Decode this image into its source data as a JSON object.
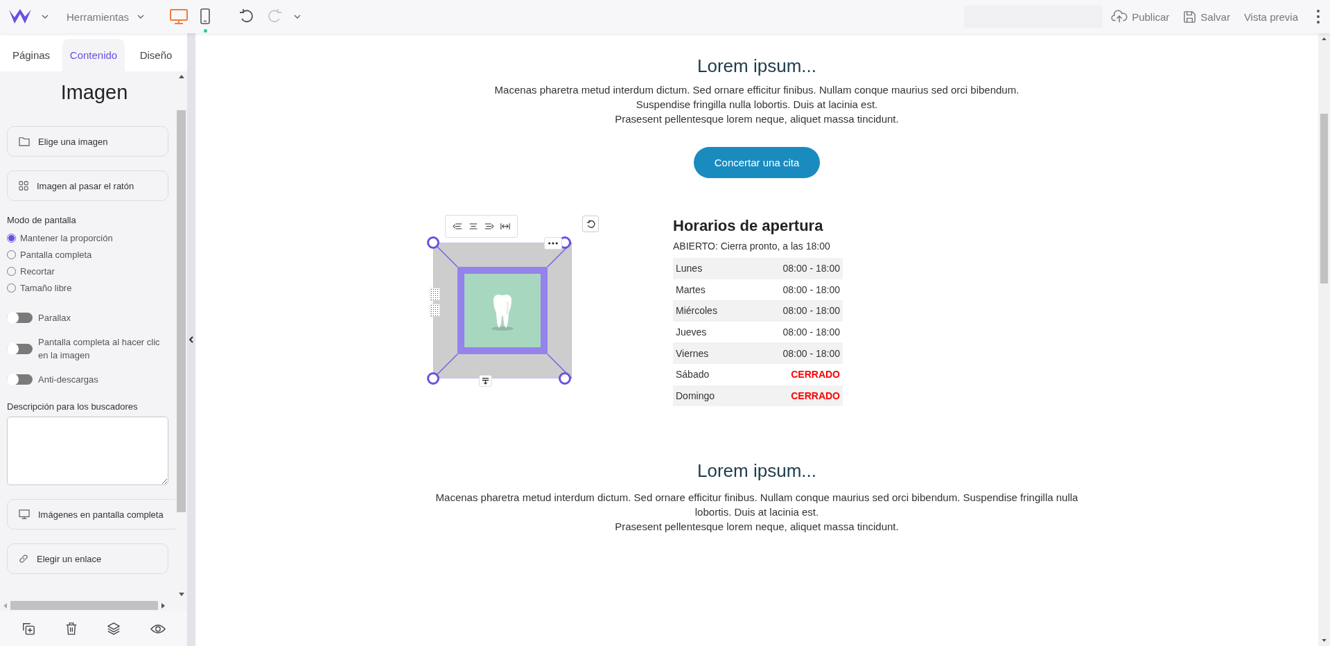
{
  "topbar": {
    "menu": "Herramientas",
    "devices": [
      {
        "kind": "desktop",
        "selected": true
      },
      {
        "kind": "mobile",
        "selected": false
      }
    ],
    "history": [
      {
        "kind": "undo",
        "disabled": false
      },
      {
        "kind": "redo",
        "disabled": true
      }
    ],
    "actions": [
      {
        "kind": "upload",
        "label": "Publicar"
      },
      {
        "kind": "save",
        "label": "Salvar"
      },
      {
        "kind": "none",
        "label": "Vista previa"
      }
    ]
  },
  "panel": {
    "tabs": [
      {
        "label": "Páginas",
        "selected": false
      },
      {
        "label": "Contenido",
        "selected": true
      },
      {
        "label": "Diseño",
        "selected": false
      }
    ],
    "title": "Imagen",
    "buttons": [
      {
        "kind": "folder",
        "label": "Elige una imagen"
      },
      {
        "kind": "grid",
        "label": "Imagen al pasar el ratón"
      }
    ],
    "mode_label": "Modo de pantalla",
    "modes": [
      {
        "label": "Mantener la proporción",
        "selected": true
      },
      {
        "label": "Pantalla completa",
        "selected": false
      },
      {
        "label": "Recortar",
        "selected": false
      },
      {
        "label": "Tamaño libre",
        "selected": false
      }
    ],
    "toggles": [
      {
        "label": "Parallax",
        "on": false
      },
      {
        "label": "Pantalla completa al hacer clic en la imagen",
        "on": false
      },
      {
        "label": "Anti-descargas",
        "on": false
      }
    ],
    "description_label": "Descripción para los buscadores",
    "more_buttons": [
      {
        "kind": "monitor",
        "label": "Imágenes en pantalla completa"
      },
      {
        "kind": "link",
        "label": "Elegir un enlace"
      }
    ]
  },
  "canvas": {
    "intro": {
      "heading": "Lorem ipsum...",
      "lines": [
        "Macenas pharetra metud interdum dictum. Sed ornare efficitur finibus. Nullam conque maurius sed orci bibendum.",
        "Suspendise fringilla nulla lobortis. Duis at lacinia est.",
        "Prasesent pellentesque lorem neque, aliquet massa tincidunt."
      ],
      "button": "Concertar una cita"
    },
    "hours": {
      "heading": "Horarios de apertura",
      "status": "ABIERTO: Cierra pronto, a las 18:00",
      "rows": [
        {
          "day": "Lunes",
          "hours": "08:00 - 18:00",
          "closed": false
        },
        {
          "day": "Martes",
          "hours": "08:00 - 18:00",
          "closed": false
        },
        {
          "day": "Miércoles",
          "hours": "08:00 - 18:00",
          "closed": false
        },
        {
          "day": "Jueves",
          "hours": "08:00 - 18:00",
          "closed": false
        },
        {
          "day": "Viernes",
          "hours": "08:00 - 18:00",
          "closed": false
        },
        {
          "day": "Sábado",
          "hours": "CERRADO",
          "closed": true
        },
        {
          "day": "Domingo",
          "hours": "CERRADO",
          "closed": true
        }
      ]
    },
    "outro": {
      "heading": "Lorem ipsum...",
      "lines": [
        "Macenas pharetra metud interdum dictum. Sed ornare efficitur finibus. Nullam conque maurius sed orci bibendum. Suspendise fringilla nulla lobortis. Duis at lacinia est.",
        "Prasesent pellentesque lorem neque, aliquet massa tincidunt."
      ]
    }
  }
}
